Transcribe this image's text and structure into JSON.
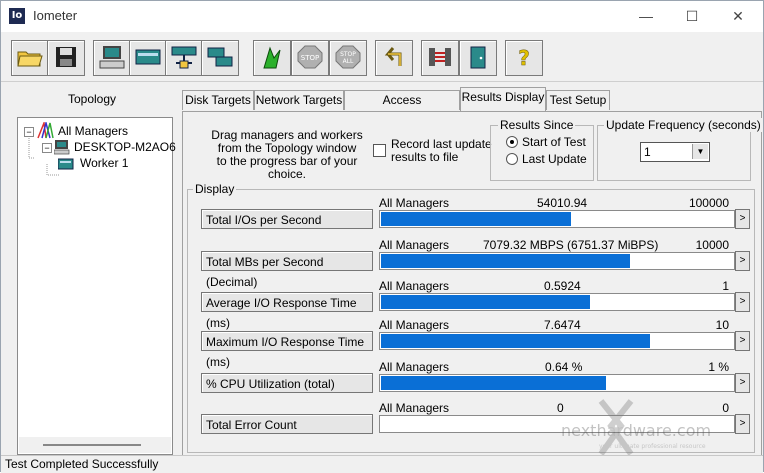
{
  "window": {
    "title": "Iometer",
    "icon_text": "Io"
  },
  "window_controls": {
    "minimize": "—",
    "maximize": "☐",
    "close": "✕"
  },
  "toolbar": {
    "buttons": [
      {
        "icon": "open-folder-icon"
      },
      {
        "icon": "save-disk-icon"
      },
      {
        "icon": "new-manager-icon"
      },
      {
        "icon": "new-worker-icon"
      },
      {
        "icon": "network-worker-icon"
      },
      {
        "icon": "duplicate-worker-icon"
      },
      {
        "icon": "start-flag-icon"
      },
      {
        "icon": "stop-icon",
        "label": "STOP"
      },
      {
        "icon": "stop-all-icon",
        "label": "STOP ALL"
      },
      {
        "icon": "reset-workers-icon"
      },
      {
        "icon": "disconnect-icon"
      },
      {
        "icon": "exit-door-icon"
      },
      {
        "icon": "help-icon",
        "label": "?"
      }
    ]
  },
  "topology": {
    "title": "Topology",
    "tree": [
      {
        "label": "All Managers",
        "expander": "−"
      },
      {
        "label": "DESKTOP-M2AO6",
        "expander": "−"
      },
      {
        "label": "Worker 1"
      }
    ]
  },
  "tabs": [
    {
      "label": "Disk Targets"
    },
    {
      "label": "Network Targets"
    },
    {
      "label": "Access Specifications"
    },
    {
      "label": "Results Display",
      "active": true
    },
    {
      "label": "Test Setup"
    }
  ],
  "results": {
    "drag_text_lines": [
      "Drag managers and workers",
      "from the Topology window",
      "to the progress bar of your choice."
    ],
    "record_last_update": {
      "line1": "Record last update",
      "line2": "results to file",
      "checked": false
    },
    "results_since": {
      "title": "Results Since",
      "options": [
        {
          "label": "Start of Test",
          "selected": true
        },
        {
          "label": "Last Update",
          "selected": false
        }
      ]
    },
    "update_frequency": {
      "title": "Update Frequency (seconds)",
      "value": "1",
      "arrow": "▼"
    },
    "display_title": "Display",
    "metrics": [
      {
        "label": "Total I/Os per Second",
        "manager": "All Managers",
        "value": "54010.94",
        "max": "100000",
        "fill": 0.54,
        "arrow": ">"
      },
      {
        "label": "Total MBs per Second (Decimal)",
        "manager": "All Managers",
        "value": "7079.32 MBPS (6751.37 MiBPS)",
        "max": "10000",
        "fill": 0.708,
        "arrow": ">"
      },
      {
        "label": "Average I/O Response Time (ms)",
        "manager": "All Managers",
        "value": "0.5924",
        "max": "1",
        "fill": 0.5924,
        "arrow": ">"
      },
      {
        "label": "Maximum I/O Response Time (ms)",
        "manager": "All Managers",
        "value": "7.6474",
        "max": "10",
        "fill": 0.7647,
        "arrow": ">"
      },
      {
        "label": "% CPU Utilization (total)",
        "manager": "All Managers",
        "value": "0.64 %",
        "max": "1 %",
        "fill": 0.64,
        "arrow": ">"
      },
      {
        "label": "Total Error Count",
        "manager": "All Managers",
        "value": "0",
        "max": "0",
        "fill": 0,
        "arrow": ">"
      }
    ]
  },
  "status": {
    "text": "Test Completed Successfully"
  },
  "watermark": {
    "text": "nexthardware.com",
    "tagline": "your ultimate professional resource"
  },
  "colors": {
    "bar_fill": "#0a6fd6",
    "accent": "#1e2a52"
  }
}
